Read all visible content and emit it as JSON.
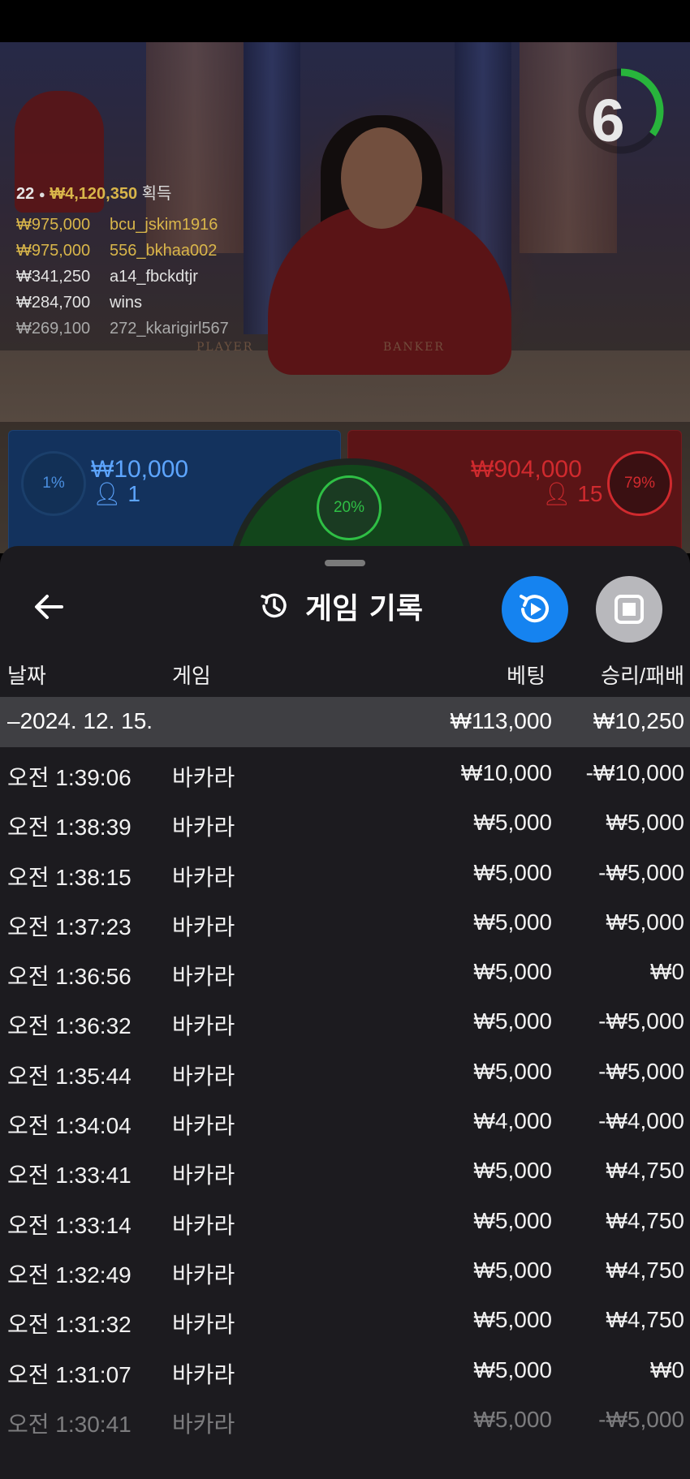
{
  "timer": {
    "seconds": "6",
    "progress_fraction": 0.35,
    "color": "#28b43c"
  },
  "winners": {
    "count": "22",
    "total": "₩4,120,350",
    "suffix": "획득",
    "list": [
      {
        "amount": "₩975,000",
        "user": "bcu_jskim1916",
        "style": "gold"
      },
      {
        "amount": "₩975,000",
        "user": "556_bkhaa002",
        "style": "gold"
      },
      {
        "amount": "₩341,250",
        "user": "a14_fbckdtjr",
        "style": "white"
      },
      {
        "amount": "₩284,700",
        "user": "wins",
        "style": "white"
      },
      {
        "amount": "₩269,100",
        "user": "272_kkarigirl567",
        "style": "faded"
      }
    ]
  },
  "table_labels": {
    "player": "PLAYER",
    "banker": "BANKER"
  },
  "bets": {
    "player": {
      "percent": "1%",
      "amount": "₩10,000",
      "count": "1",
      "color": "#5da5ff"
    },
    "tie": {
      "percent": "20%",
      "color": "#28b43c"
    },
    "banker": {
      "percent": "79%",
      "amount": "₩904,000",
      "count": "15",
      "color": "#d02a2e"
    }
  },
  "sheet": {
    "title": "게임 기록",
    "icons": {
      "back": "arrow-left-icon",
      "history": "history-icon",
      "replay": "replay-icon",
      "stop": "stop-icon"
    },
    "columns": {
      "date": "날짜",
      "game": "게임",
      "bet": "베팅",
      "result": "승리/패배"
    },
    "date_group": {
      "date": "–2024. 12. 15.",
      "total_bet": "₩113,000",
      "total_result": "₩10,250"
    },
    "rows": [
      {
        "time": "오전 1:39:06",
        "game": "바카라",
        "bet": "₩10,000",
        "result": "-₩10,000"
      },
      {
        "time": "오전 1:38:39",
        "game": "바카라",
        "bet": "₩5,000",
        "result": "₩5,000"
      },
      {
        "time": "오전 1:38:15",
        "game": "바카라",
        "bet": "₩5,000",
        "result": "-₩5,000"
      },
      {
        "time": "오전 1:37:23",
        "game": "바카라",
        "bet": "₩5,000",
        "result": "₩5,000"
      },
      {
        "time": "오전 1:36:56",
        "game": "바카라",
        "bet": "₩5,000",
        "result": "₩0"
      },
      {
        "time": "오전 1:36:32",
        "game": "바카라",
        "bet": "₩5,000",
        "result": "-₩5,000"
      },
      {
        "time": "오전 1:35:44",
        "game": "바카라",
        "bet": "₩5,000",
        "result": "-₩5,000"
      },
      {
        "time": "오전 1:34:04",
        "game": "바카라",
        "bet": "₩4,000",
        "result": "-₩4,000"
      },
      {
        "time": "오전 1:33:41",
        "game": "바카라",
        "bet": "₩5,000",
        "result": "₩4,750"
      },
      {
        "time": "오전 1:33:14",
        "game": "바카라",
        "bet": "₩5,000",
        "result": "₩4,750"
      },
      {
        "time": "오전 1:32:49",
        "game": "바카라",
        "bet": "₩5,000",
        "result": "₩4,750"
      },
      {
        "time": "오전 1:31:32",
        "game": "바카라",
        "bet": "₩5,000",
        "result": "₩4,750"
      },
      {
        "time": "오전 1:31:07",
        "game": "바카라",
        "bet": "₩5,000",
        "result": "₩0"
      },
      {
        "time": "오전 1:30:41",
        "game": "바카라",
        "bet": "₩5,000",
        "result": "-₩5,000"
      }
    ]
  }
}
